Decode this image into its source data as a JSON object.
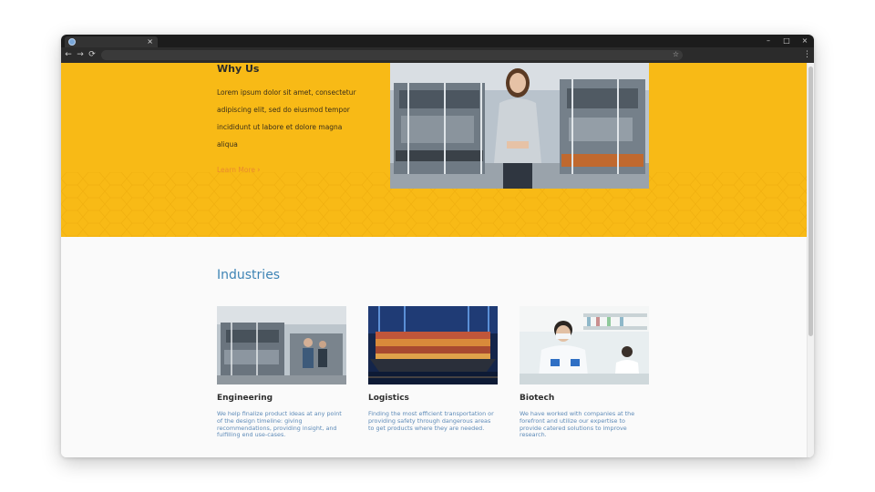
{
  "browser": {
    "tab_close": "×",
    "controls": {
      "minimize": "–",
      "maximize": "□",
      "close": "×"
    },
    "nav": {
      "back": "←",
      "forward": "→",
      "reload": "⟳",
      "star": "☆",
      "menu": "⋮"
    }
  },
  "hero": {
    "title": "Why Us",
    "lines": [
      "Lorem ipsum dolor sit amet, consectetur",
      "adipiscing elit, sed do eiusmod tempor",
      "incididunt ut labore et dolore magna",
      "aliqua"
    ],
    "learn_more": "Learn More",
    "learn_more_chevron": "›",
    "background_color": "#f8ba16",
    "link_color": "#e98a2e"
  },
  "industries": {
    "title": "Industries",
    "cards": [
      {
        "title": "Engineering",
        "desc": "We help finalize product ideas at any point of the design timeline: giving recommendations, providing insight, and fulfilling end use-cases."
      },
      {
        "title": "Logistics",
        "desc": "Finding the most efficient transportation or providing safety through dangerous areas to get products where they are needed."
      },
      {
        "title": "Biotech",
        "desc": "We have worked with companies at the forefront and utilize our expertise to provide catered solutions to improve research."
      }
    ],
    "title_color": "#3e84b5",
    "desc_color": "#5e8bb8"
  }
}
